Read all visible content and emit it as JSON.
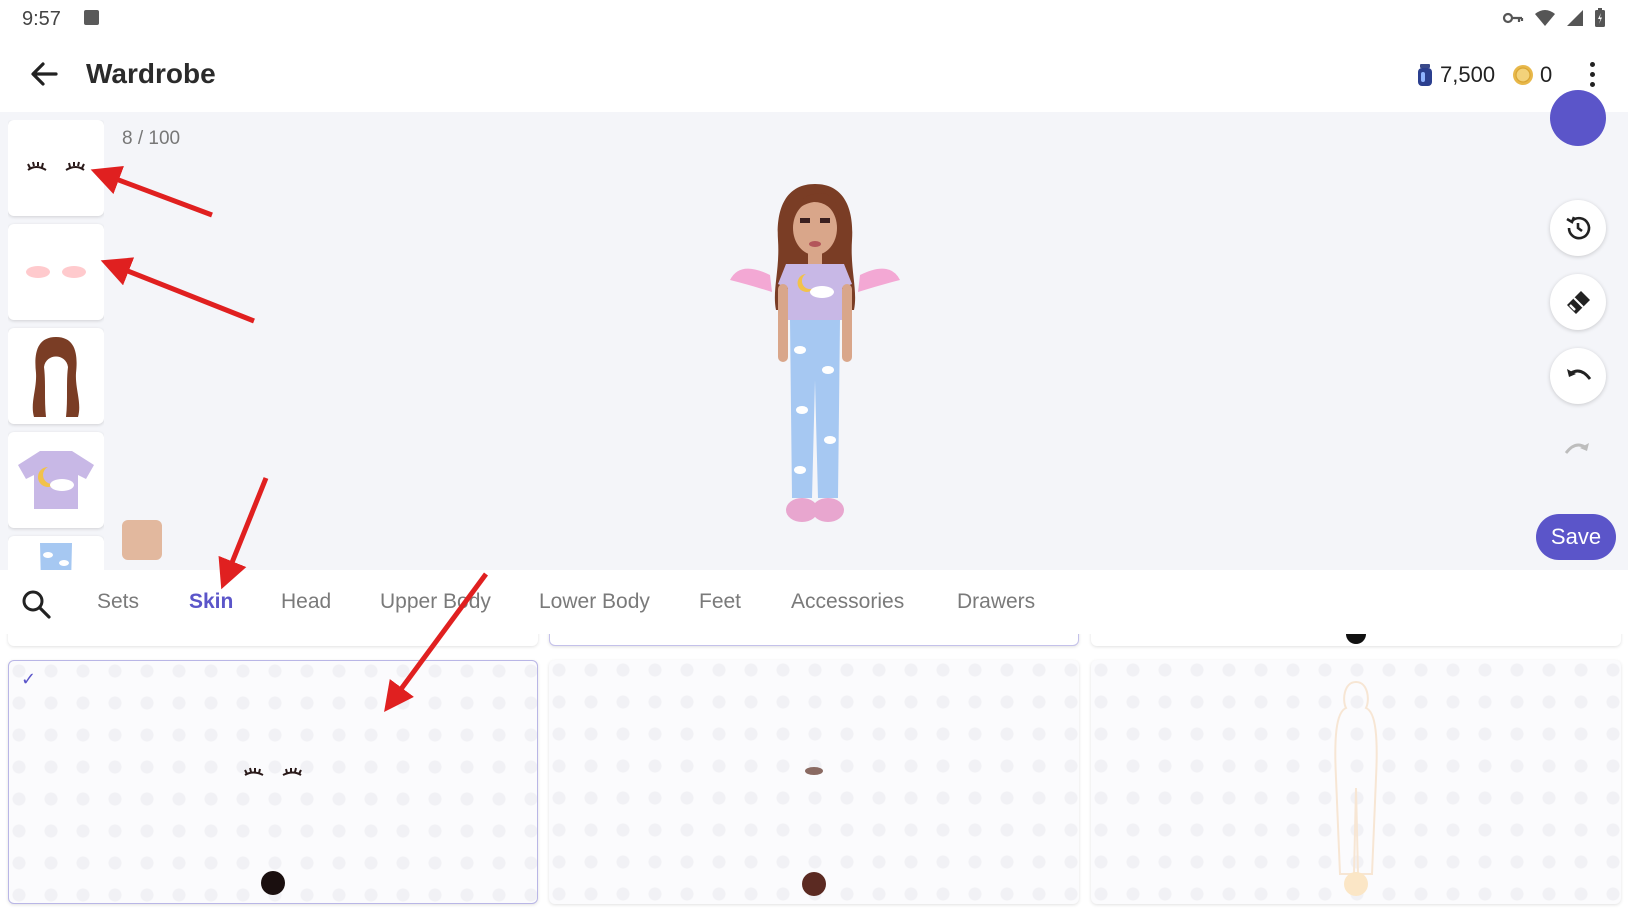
{
  "status_bar": {
    "time": "9:57"
  },
  "app_bar": {
    "title": "Wardrobe",
    "gems": "7,500",
    "coins": "0"
  },
  "canvas": {
    "counter": "8 / 100",
    "thumbnails": [
      "eyelashes",
      "blush",
      "hair",
      "top",
      "pants"
    ],
    "skin_color": "#e2b89e",
    "save_label": "Save"
  },
  "tabs": [
    {
      "label": "Sets"
    },
    {
      "label": "Skin"
    },
    {
      "label": "Head"
    },
    {
      "label": "Upper Body"
    },
    {
      "label": "Lower Body"
    },
    {
      "label": "Feet"
    },
    {
      "label": "Accessories"
    },
    {
      "label": "Drawers"
    }
  ],
  "active_tab": "Skin",
  "grid": {
    "cards": [
      {
        "item": "eyelashes",
        "selected": true,
        "color": "#1a0f0f"
      },
      {
        "item": "brows",
        "selected": false,
        "color": "#5b2a22"
      },
      {
        "item": "body-outline",
        "selected": false,
        "color": "#fbe6c6"
      }
    ]
  },
  "colors": {
    "accent": "#5b55c9",
    "annotation": "#e02020"
  }
}
